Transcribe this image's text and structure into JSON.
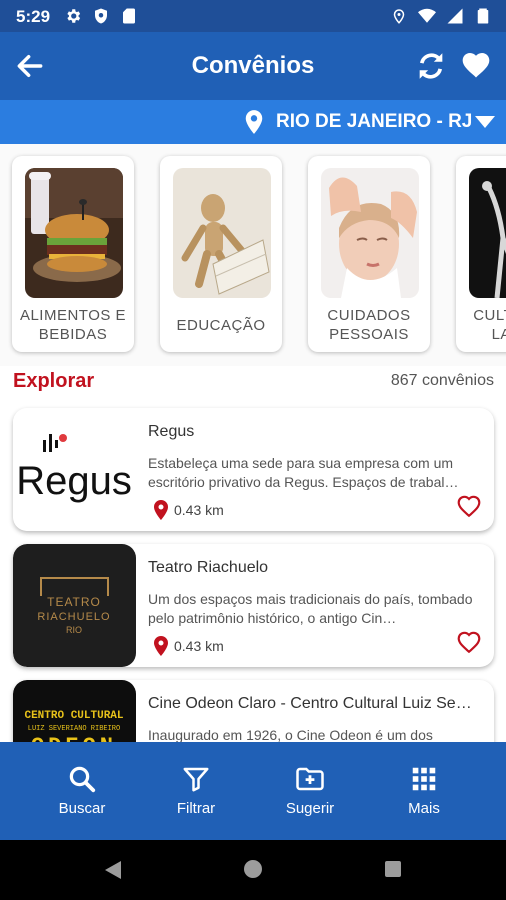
{
  "status_bar": {
    "time": "5:29"
  },
  "app_bar": {
    "title": "Convênios"
  },
  "location": {
    "label": "RIO DE JANEIRO - RJ"
  },
  "categories": [
    {
      "label": "ALIMENTOS E BEBIDAS"
    },
    {
      "label": "EDUCAÇÃO"
    },
    {
      "label": "CUIDADOS PESSOAIS"
    },
    {
      "label": "CULTURA E LAZER"
    }
  ],
  "explore": {
    "title": "Explorar",
    "count": "867 convênios"
  },
  "items": [
    {
      "title": "Regus",
      "description": "Estabeleça uma sede para sua empresa com um escritório privativo da Regus. Espaços de trabal…",
      "distance": "0.43 km",
      "logo_text": "Regus"
    },
    {
      "title": "Teatro Riachuelo",
      "description": "Um dos espaços mais tradicionais do país, tombado pelo patrimônio histórico, o antigo Cin…",
      "distance": "0.43 km",
      "logo_line1": "TEATRO",
      "logo_line2": "RIACHUELO",
      "logo_line3": "RIO"
    },
    {
      "title": "Cine Odeon Claro - Centro Cultural Luiz Se…",
      "description": "Inaugurado em 1926, o Cine Odeon é um dos",
      "distance": "",
      "logo_line1": "CENTRO CULTURAL",
      "logo_line2": "LUIZ SEVERIANO RIBEIRO",
      "logo_line3": "ODEON"
    }
  ],
  "bottom_nav": [
    {
      "label": "Buscar",
      "icon": "search-icon"
    },
    {
      "label": "Filtrar",
      "icon": "filter-icon"
    },
    {
      "label": "Sugerir",
      "icon": "folder-add-icon"
    },
    {
      "label": "Mais",
      "icon": "grid-icon"
    }
  ],
  "colors": {
    "primary": "#2060b6",
    "status": "#1f4f98",
    "location": "#2b7de0",
    "accent": "#c1121f"
  }
}
